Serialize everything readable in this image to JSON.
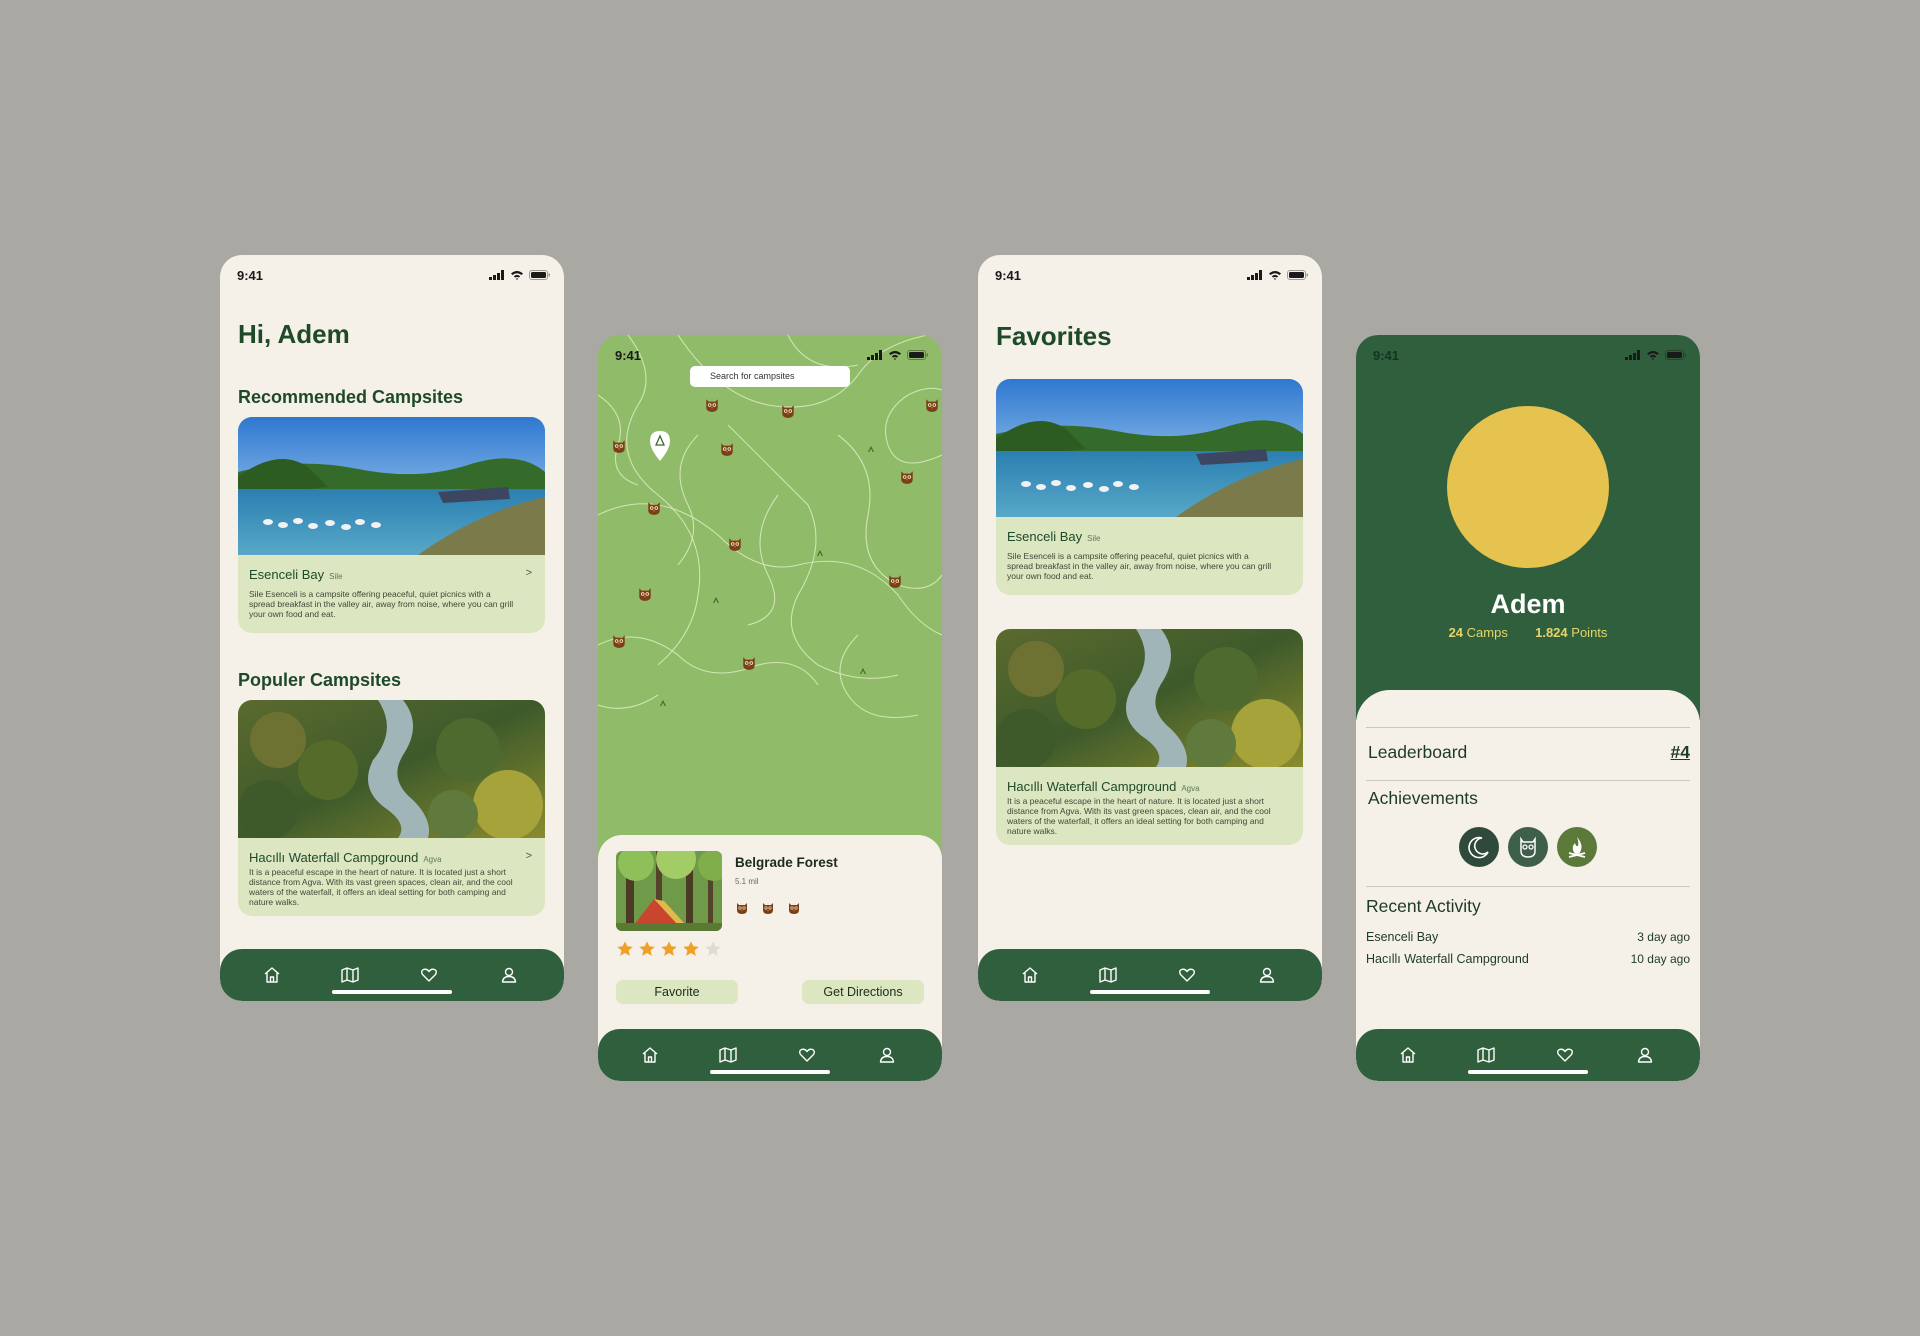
{
  "status": {
    "time": "9:41"
  },
  "home": {
    "greeting": "Hi, Adem",
    "recommended_title": "Recommended Campsites",
    "popular_title": "Populer Campsites",
    "recommended": {
      "name": "Esenceli Bay",
      "location": "Sile",
      "description": "Sile Esenceli is a campsite offering peaceful, quiet picnics with a spread breakfast in the valley air, away from noise, where you can grill your own food and eat."
    },
    "popular": {
      "name": "Hacıllı Waterfall Campground",
      "location": "Agva",
      "description": "It is a peaceful escape in the heart of nature. It is located just a short distance from Agva. With its vast green spaces, clean air, and the cool waters of the waterfall, it offers an ideal setting for both camping and nature walks."
    }
  },
  "map": {
    "search_placeholder": "Search for campsites",
    "place": {
      "name": "Belgrade Forest",
      "distance": "5.1 mil",
      "rating": 4,
      "rating_max": 5
    },
    "favorite_label": "Favorite",
    "directions_label": "Get Directions"
  },
  "favorites": {
    "title": "Favorites",
    "items": [
      {
        "name": "Esenceli Bay",
        "location": "Sile",
        "description": "Sile Esenceli is a campsite offering peaceful, quiet picnics with a spread breakfast in the valley air, away from noise, where you can grill your own food and eat."
      },
      {
        "name": "Hacıllı Waterfall Campground",
        "location": "Agva",
        "description": "It is a peaceful escape in the heart of nature. It is located just a short distance from Agva. With its vast green spaces, clean air, and the cool waters of the waterfall, it offers an ideal setting for both camping and nature walks."
      }
    ]
  },
  "profile": {
    "name": "Adem",
    "camps_count": "24",
    "camps_label": "Camps",
    "points_count": "1.824",
    "points_label": "Points",
    "leaderboard_label": "Leaderboard",
    "rank": "#4",
    "achievements_label": "Achievements",
    "achievements": [
      "moon-icon",
      "owl-icon",
      "campfire-icon"
    ],
    "recent_label": "Recent Activity",
    "recent": [
      {
        "name": "Esenceli Bay",
        "when": "3 day ago"
      },
      {
        "name": "Hacıllı Waterfall Campground",
        "when": "10 day ago"
      }
    ]
  },
  "nav": [
    "home-icon",
    "map-icon",
    "heart-icon",
    "profile-icon"
  ],
  "colors": {
    "primary": "#2f5f3d",
    "card": "#dce6c0",
    "background": "#f5f1e8",
    "map": "#90bb68",
    "avatar": "#e6c34e",
    "star": "#f0a028"
  }
}
